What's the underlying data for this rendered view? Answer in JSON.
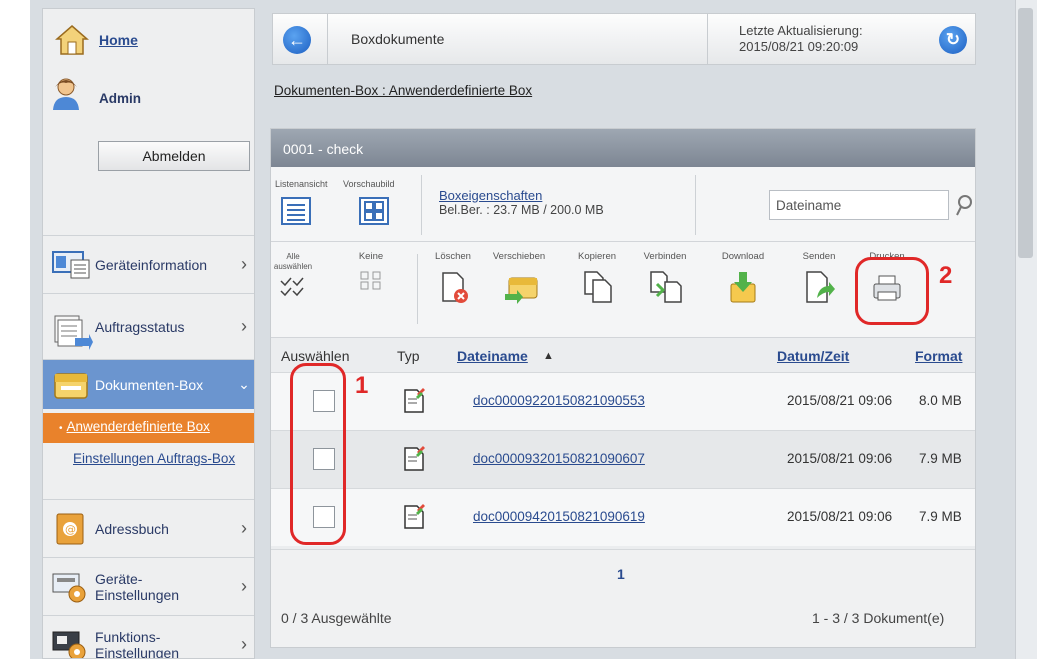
{
  "sidebar": {
    "home": "Home",
    "user": "Admin",
    "logout": "Abmelden",
    "items": [
      {
        "label": "Geräteinformation"
      },
      {
        "label": "Auftragsstatus"
      },
      {
        "label": "Dokumenten-Box"
      },
      {
        "label": "Adressbuch"
      },
      {
        "label": "Geräte-\nEinstellungen"
      },
      {
        "label": "Funktions-\nEinstellungen"
      }
    ],
    "sub": [
      {
        "label": "Anwenderdefinierte Box"
      },
      {
        "label": "Einstellungen Auftrags-Box"
      }
    ]
  },
  "header": {
    "title": "Boxdokumente",
    "update_label": "Letzte Aktualisierung:",
    "update_time": "2015/08/21 09:20:09"
  },
  "breadcrumb": "Dokumenten-Box : Anwenderdefinierte Box",
  "box": {
    "title": "0001 - check",
    "view_list": "Listenansicht",
    "view_preview": "Vorschaubild",
    "properties": "Boxeigenschaften",
    "usage": "Bel.Ber. : 23.7 MB / 200.0 MB",
    "search_placeholder": "Dateiname"
  },
  "actions": {
    "select_all": "Alle auswählen",
    "none": "Keine",
    "delete": "Löschen",
    "move": "Verschieben",
    "copy": "Kopieren",
    "join": "Verbinden",
    "download": "Download",
    "send": "Senden",
    "print": "Drucken"
  },
  "columns": {
    "select": "Auswählen",
    "type": "Typ",
    "name": "Dateiname",
    "sort_indicator": "▲",
    "date": "Datum/Zeit",
    "format": "Format"
  },
  "rows": [
    {
      "name": "doc00009220150821090553",
      "date": "2015/08/21 09:06",
      "size": "8.0 MB"
    },
    {
      "name": "doc00009320150821090607",
      "date": "2015/08/21 09:06",
      "size": "7.9 MB"
    },
    {
      "name": "doc00009420150821090619",
      "date": "2015/08/21 09:06",
      "size": "7.9 MB"
    }
  ],
  "pager": {
    "page": "1",
    "selected": "0 / 3 Ausgewählte",
    "count": "1 - 3 / 3 Dokument(e)"
  },
  "annotations": {
    "one": "1",
    "two": "2"
  },
  "colors": {
    "accent": "#6b95cf",
    "current_sub": "#e9822b",
    "annotation": "#e02828"
  }
}
